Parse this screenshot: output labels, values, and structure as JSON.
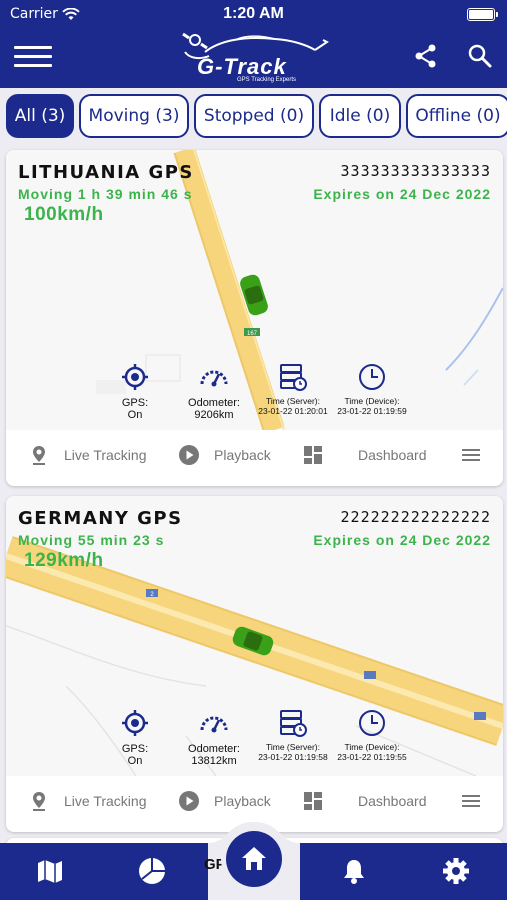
{
  "status_bar": {
    "carrier": "Carrier",
    "time": "1:20 AM"
  },
  "header": {
    "brand": "G-Track",
    "tagline": "GPS Tracking Experts"
  },
  "filters": [
    {
      "label": "All (3)",
      "active": true
    },
    {
      "label": "Moving (3)",
      "active": false
    },
    {
      "label": "Stopped (0)",
      "active": false
    },
    {
      "label": "Idle (0)",
      "active": false
    },
    {
      "label": "Offline (0)",
      "active": false
    }
  ],
  "vehicles": [
    {
      "name": "LITHUANIA GPS",
      "imei": "333333333333333",
      "status": "Moving 1 h 39 min 46 s",
      "expires": "Expires on 24 Dec 2022",
      "speed": "100km/h",
      "road_label": "167",
      "gps_label": "GPS:",
      "gps_value": "On",
      "odometer_label": "Odometer:",
      "odometer_value": "9206km",
      "time_server_label": "Time (Server):",
      "time_server_value": "23-01-22 01:20:01",
      "time_device_label": "Time (Device):",
      "time_device_value": "23-01-22 01:19:59"
    },
    {
      "name": "GERMANY GPS",
      "imei": "222222222222222",
      "status": "Moving 55 min 23 s",
      "expires": "Expires on 24 Dec 2022",
      "speed": "129km/h",
      "road_label": "2",
      "gps_label": "GPS:",
      "gps_value": "On",
      "odometer_label": "Odometer:",
      "odometer_value": "13812km",
      "time_server_label": "Time (Server):",
      "time_server_value": "23-01-22 01:19:58",
      "time_device_label": "Time (Device):",
      "time_device_value": "23-01-22 01:19:55"
    }
  ],
  "card_actions": {
    "live_tracking": "Live Tracking",
    "playback": "Playback",
    "dashboard": "Dashboard"
  },
  "partial_text": "GP",
  "colors": {
    "primary": "#1b2a8c",
    "accent_green": "#3cb44b",
    "road": "#f6d57c"
  }
}
